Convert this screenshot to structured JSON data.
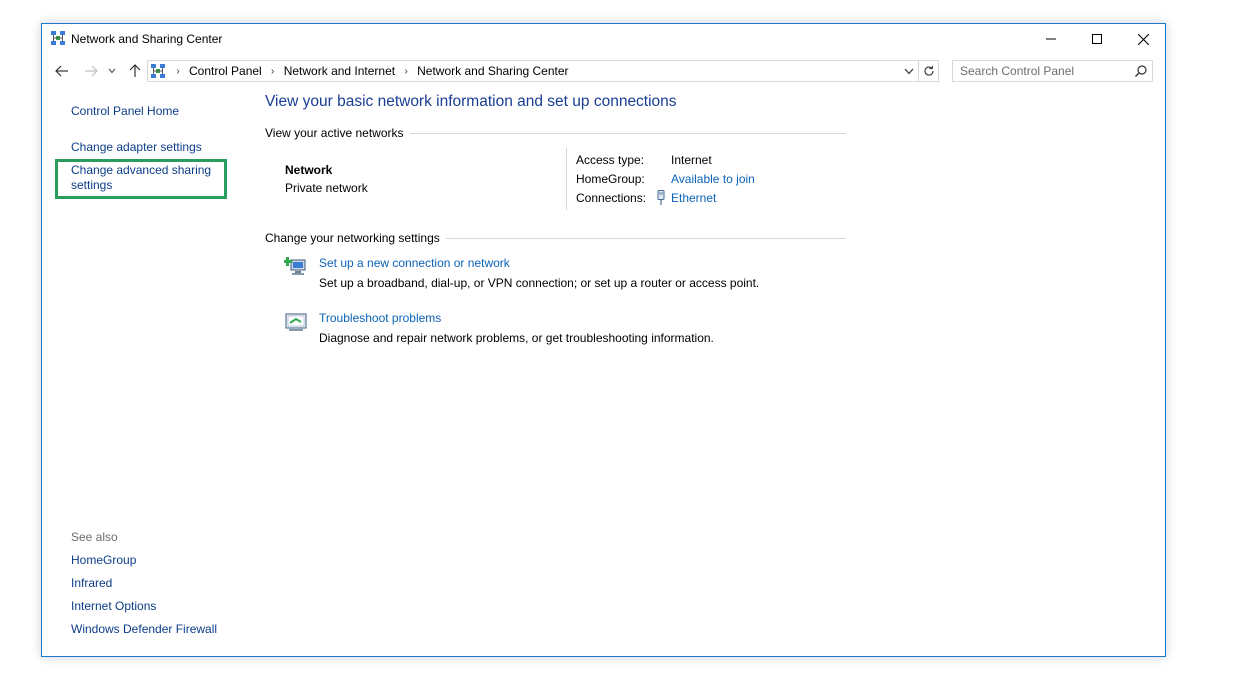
{
  "window": {
    "title": "Network and Sharing Center",
    "accent": "#1979ca"
  },
  "address_bar": {
    "crumbs": [
      "Control Panel",
      "Network and Internet",
      "Network and Sharing Center"
    ]
  },
  "search": {
    "placeholder": "Search Control Panel"
  },
  "left_pane": {
    "home": "Control Panel Home",
    "adapter": "Change adapter settings",
    "advanced": "Change advanced sharing settings",
    "highlight_color": "#2a9d5e",
    "see_also": {
      "heading": "See also",
      "items": [
        "HomeGroup",
        "Infrared",
        "Internet Options",
        "Windows Defender Firewall"
      ]
    }
  },
  "main": {
    "title": "View your basic network information and set up connections",
    "active_networks_heading": "View your active networks",
    "network": {
      "name": "Network",
      "type": "Private network",
      "access_type_label": "Access type:",
      "access_type_value": "Internet",
      "homegroup_label": "HomeGroup:",
      "homegroup_value": "Available to join",
      "connections_label": "Connections:",
      "connections_value": "Ethernet"
    },
    "change_settings_heading": "Change your networking settings",
    "tasks": [
      {
        "link": "Set up a new connection or network",
        "description": "Set up a broadband, dial-up, or VPN connection; or set up a router or access point."
      },
      {
        "link": "Troubleshoot problems",
        "description": "Diagnose and repair network problems, or get troubleshooting information."
      }
    ]
  },
  "icons": {
    "title": "network-center-icon",
    "back": "arrow-left-icon",
    "forward": "arrow-right-icon",
    "recent": "chevron-down-icon",
    "up": "arrow-up-icon",
    "refresh": "refresh-icon",
    "search": "search-icon",
    "ethernet": "ethernet-icon",
    "setup": "setup-connection-icon",
    "troubleshoot": "troubleshoot-icon"
  }
}
